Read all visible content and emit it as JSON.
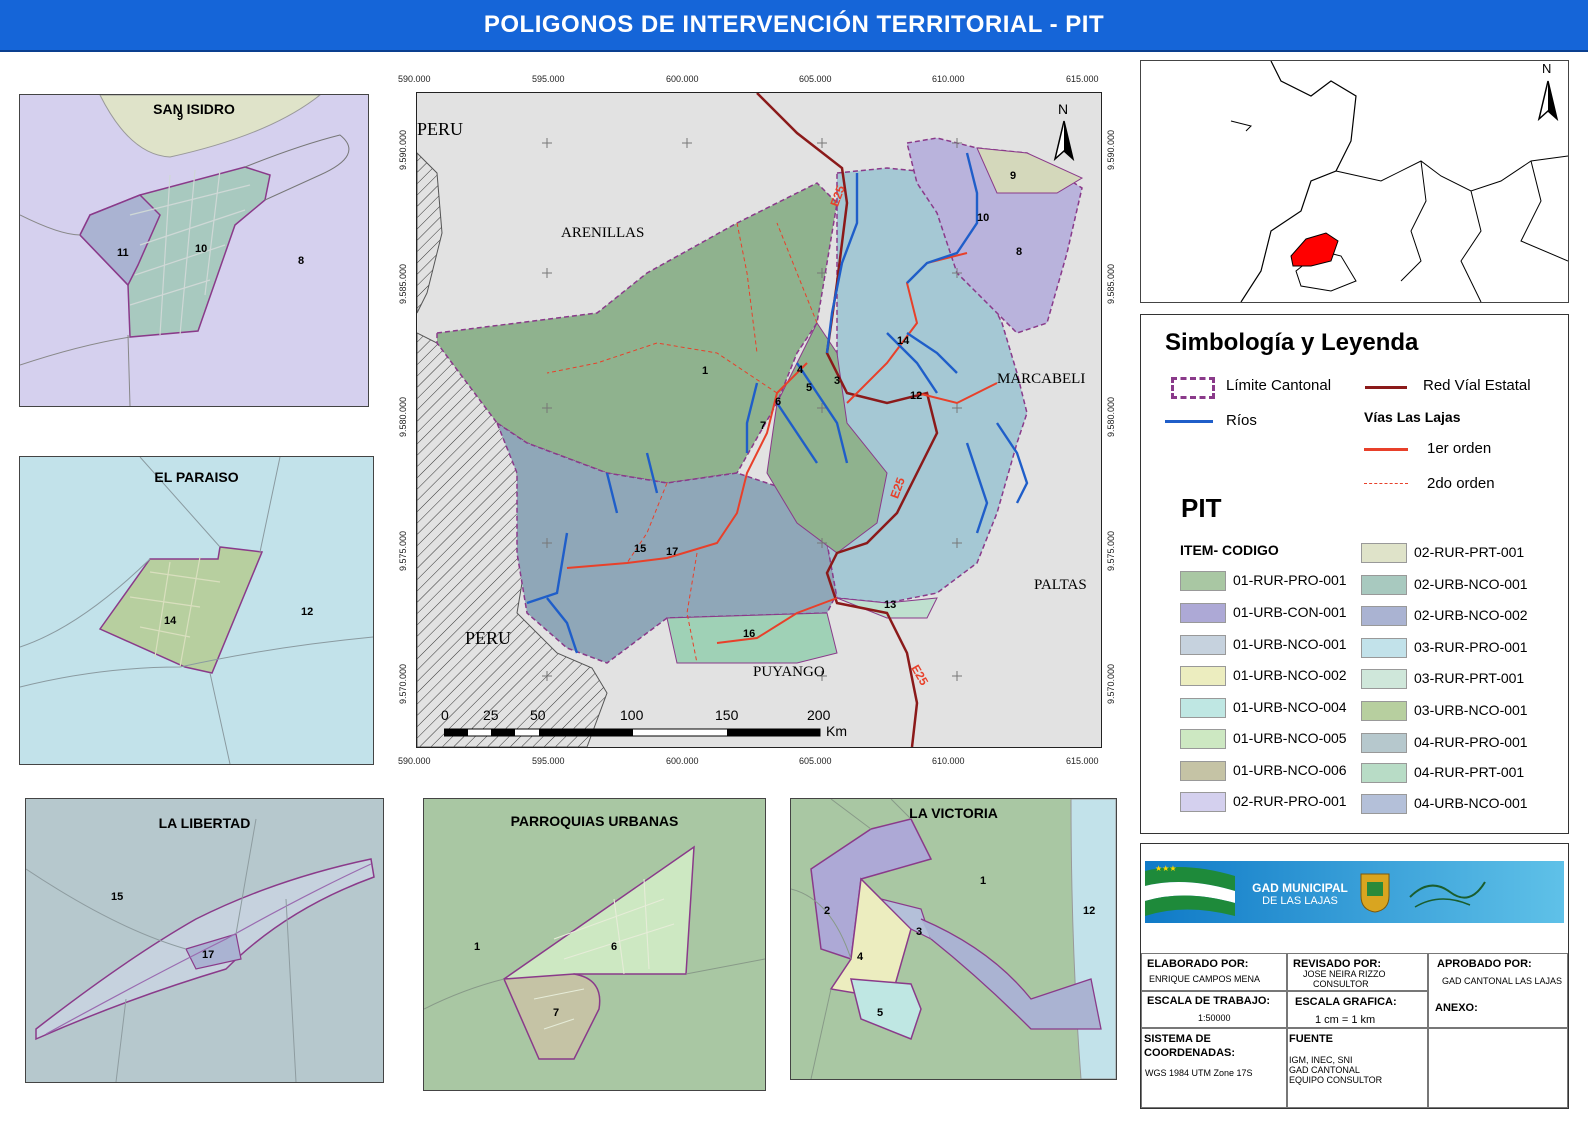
{
  "title": "POLIGONOS DE INTERVENCIÓN TERRITORIAL - PIT",
  "insets": {
    "san_isidro": {
      "title": "SAN ISIDRO",
      "labels": [
        "9",
        "11",
        "10",
        "8"
      ]
    },
    "el_paraiso": {
      "title": "EL PARAISO",
      "labels": [
        "14",
        "12"
      ]
    },
    "la_libertad": {
      "title": "LA LIBERTAD",
      "labels": [
        "15",
        "17"
      ]
    },
    "parroquias_urbanas": {
      "title": "PARROQUIAS URBANAS",
      "labels": [
        "1",
        "6",
        "7"
      ]
    },
    "la_victoria": {
      "title": "LA VICTORIA",
      "labels": [
        "1",
        "12",
        "2",
        "3",
        "4",
        "5"
      ]
    }
  },
  "main_map": {
    "x_ticks": [
      "590.000",
      "595.000",
      "600.000",
      "605.000",
      "610.000",
      "615.000"
    ],
    "y_ticks": [
      "9.590.000",
      "9.585.000",
      "9.580.000",
      "9.575.000",
      "9.570.000"
    ],
    "place_labels": {
      "peru_top": "PERU",
      "arenillas": "ARENILLAS",
      "marcabeli": "MARCABELI",
      "paltas": "PALTAS",
      "peru_bottom": "PERU",
      "puyango": "PUYANGO"
    },
    "road_labels": [
      "E25",
      "E25",
      "E25"
    ],
    "polygon_labels": [
      "1",
      "3",
      "4",
      "5",
      "6",
      "7",
      "8",
      "9",
      "10",
      "12",
      "13",
      "14",
      "15",
      "16",
      "17"
    ],
    "north": "N",
    "scale": {
      "ticks": [
        "0",
        "25",
        "50",
        "100",
        "150",
        "200"
      ],
      "unit": "Km"
    }
  },
  "locator": {
    "north": "N"
  },
  "legend": {
    "title": "Simbología y Leyenda",
    "limite": "Límite Cantonal",
    "red_vial": "Red Víal Estatal",
    "rios": "Ríos",
    "vias_title": "Vías Las Lajas",
    "orden1": "1er orden",
    "orden2": "2do orden",
    "pit_title": "PIT",
    "item_header": "ITEM- CODIGO",
    "left_items": [
      {
        "code": "01-RUR-PRO-001",
        "color": "#a9c7a3"
      },
      {
        "code": "01-URB-CON-001",
        "color": "#ada9d6"
      },
      {
        "code": "01-URB-NCO-001",
        "color": "#c6d2de"
      },
      {
        "code": "01-URB-NCO-002",
        "color": "#ecedbf"
      },
      {
        "code": "01-URB-NCO-004",
        "color": "#bfe7e3"
      },
      {
        "code": "01-URB-NCO-005",
        "color": "#cde8c2"
      },
      {
        "code": "01-URB-NCO-006",
        "color": "#c5c3a5"
      },
      {
        "code": "02-RUR-PRO-001",
        "color": "#d4d0ee"
      }
    ],
    "right_items": [
      {
        "code": "02-RUR-PRT-001",
        "color": "#dfe3c9"
      },
      {
        "code": "02-URB-NCO-001",
        "color": "#a8c9bf"
      },
      {
        "code": "02-URB-NCO-002",
        "color": "#aab3d2"
      },
      {
        "code": "03-RUR-PRO-001",
        "color": "#c2e2ea"
      },
      {
        "code": "03-RUR-PRT-001",
        "color": "#cfe7da"
      },
      {
        "code": "03-URB-NCO-001",
        "color": "#b7cf9f"
      },
      {
        "code": "04-RUR-PRO-001",
        "color": "#b6c8cd"
      },
      {
        "code": "04-RUR-PRT-001",
        "color": "#b8dcc6"
      },
      {
        "code": "04-URB-NCO-001",
        "color": "#b4c0d9"
      }
    ]
  },
  "info": {
    "banner_line1": "GAD MUNICIPAL",
    "banner_line2": "DE LAS LAJAS",
    "elaborado_label": "ELABORADO POR:",
    "elaborado_value": "ENRIQUE CAMPOS MENA",
    "revisado_label": "REVISADO POR:",
    "revisado_value1": "JOSE NEIRA RIZZO",
    "revisado_value2": "CONSULTOR",
    "aprobado_label": "APROBADO POR:",
    "aprobado_value": "GAD CANTONAL LAS LAJAS",
    "escala_trabajo_label": "ESCALA DE TRABAJO:",
    "escala_trabajo_value": "1:50000",
    "escala_grafica_label": "ESCALA GRAFICA:",
    "escala_grafica_value": "1 cm = 1 km",
    "anexo_label": "ANEXO:",
    "sistema_label1": "SISTEMA DE",
    "sistema_label2": "COORDENADAS:",
    "sistema_value": "WGS 1984 UTM Zone 17S",
    "fuente_label": "FUENTE",
    "fuente_value1": "IGM, INEC, SNI",
    "fuente_value2": "GAD CANTONAL",
    "fuente_value3": "EQUIPO CONSULTOR"
  }
}
